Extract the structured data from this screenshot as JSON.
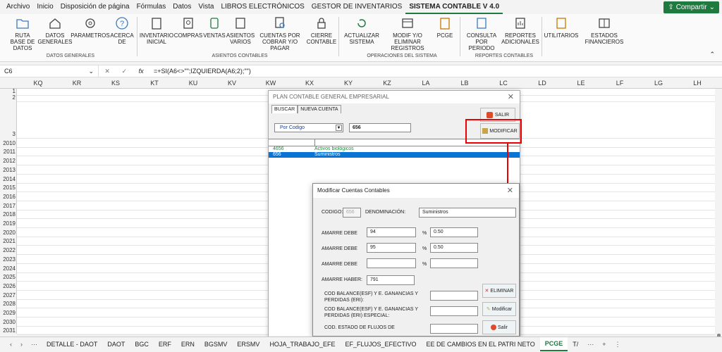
{
  "menu": {
    "items": [
      "Archivo",
      "Inicio",
      "Disposición de página",
      "Fórmulas",
      "Datos",
      "Vista",
      "LIBROS ELECTRÓNICOS",
      "GESTOR DE INVENTARIOS",
      "SISTEMA CONTABLE V 4.0"
    ],
    "share_label": "Compartir"
  },
  "ribbon": {
    "buttons": [
      {
        "label": "RUTA BASE DE DATOS"
      },
      {
        "label": "DATOS GENERALES"
      },
      {
        "label": "PARAMETROS"
      },
      {
        "label": "ACERCA DE"
      },
      {
        "label": "INVENTARIO INICIAL"
      },
      {
        "label": "COMPRAS"
      },
      {
        "label": "VENTAS"
      },
      {
        "label": "ASIENTOS VARIOS"
      },
      {
        "label": "CUENTAS POR COBRAR Y/O PAGAR"
      },
      {
        "label": "CIERRE CONTABLE"
      },
      {
        "label": "ACTUALIZAR SISTEMA"
      },
      {
        "label": "MODIF Y/O ELIMINAR REGISTROS"
      },
      {
        "label": "PCGE"
      },
      {
        "label": "CONSULTA POR PERIODO"
      },
      {
        "label": "REPORTES ADICIONALES"
      },
      {
        "label": "UTILITARIOS"
      },
      {
        "label": "ESTADOS FINANCIEROS"
      }
    ],
    "groups": [
      "DATOS GENERALES",
      "ASIENTOS CONTABLES",
      "OPERACIONES DEL SISTEMA",
      "REPORTES CONTABLES"
    ]
  },
  "formula_bar": {
    "cell": "C6",
    "formula": "=+SI(A6<>\"\";IZQUIERDA(A6;2);\"\")"
  },
  "columns": [
    "KQ",
    "KR",
    "KS",
    "KT",
    "KU",
    "KV",
    "KW",
    "KX",
    "KY",
    "KZ",
    "LA",
    "LB",
    "LC",
    "LD",
    "LE",
    "LF",
    "LG",
    "LH"
  ],
  "rows": [
    "1",
    "2",
    "3",
    "2010",
    "2011",
    "2012",
    "2013",
    "2014",
    "2015",
    "2016",
    "2017",
    "2018",
    "2019",
    "2020",
    "2021",
    "2022",
    "2023",
    "2024",
    "2025",
    "2026",
    "2027",
    "2028",
    "2029",
    "2030",
    "2031"
  ],
  "sheet_tabs": {
    "items": [
      "DETALLE - DAOT",
      "DAOT",
      "BGC",
      "ERF",
      "ERN",
      "BGSMV",
      "ERSMV",
      "HOJA_TRABAJO_EFE",
      "EF_FLUJOS_EFECTIVO",
      "EE DE CAMBIOS EN EL PATRI NETO",
      "PCGE",
      "T/"
    ],
    "active": "PCGE"
  },
  "dialog1": {
    "title": "PLAN CONTABLE GENERAL EMPRESARIAL",
    "tab_buscar": "BUSCAR",
    "tab_nueva": "NUEVA CUENTA",
    "salir_label": "SALIR",
    "modificar_label": "MODIFICAR",
    "combo_value": "Por Codigo",
    "search_value": "656",
    "list": [
      {
        "code": "4656",
        "name": "Activos biológicos"
      },
      {
        "code": "656",
        "name": "Suministros"
      }
    ]
  },
  "dialog2": {
    "title": "Modificar Cuentas Contables",
    "codigo_label": "CODIGO:",
    "codigo_value": "656",
    "denominacion_label": "DENOMINACIÓN:",
    "denominacion_value": "Suministros",
    "amarre_debe_label": "AMARRE DEBE",
    "percent_label": "%",
    "debe1": "94",
    "pct1": "0.50",
    "debe2": "95",
    "pct2": "0.50",
    "debe3": "",
    "pct3": "",
    "amarre_haber_label": "AMARRE HABER:",
    "haber_value": "791",
    "cod_balance_label": "COD BALANCE(ESF) Y E. GANANCIAS Y PERDIDAS (ERI):",
    "cod_balance_esp_label": "COD BALANCE(ESF) Y E. GANANCIAS Y PERDIDAS (ERI) ESPECIAL:",
    "cod_flujos_label": "COD. ESTADO DE FLUJOS DE",
    "eliminar_label": "ELIMINAR",
    "modificar_label": "Modificar",
    "salir_label": "Salir"
  }
}
